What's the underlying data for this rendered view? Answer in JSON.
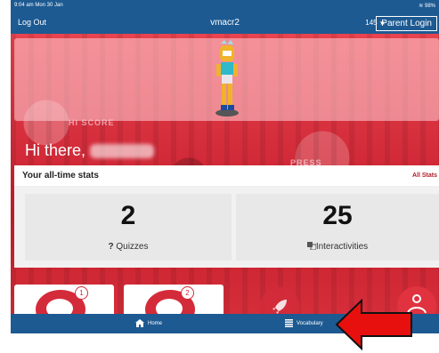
{
  "status": {
    "time": "9:04 am  Mon 30 Jan",
    "battery": "98%"
  },
  "nav": {
    "logout": "Log Out",
    "title": "vmacr2",
    "stars": "145 ★",
    "parent_login": "Parent Login"
  },
  "greeting": {
    "text": "Hi there, "
  },
  "stats": {
    "title": "Your all-time stats",
    "all_stats": "All Stats",
    "quizzes": {
      "value": "2",
      "icon": "?",
      "label": "Quizzes"
    },
    "interactivities": {
      "value": "25",
      "label": "Interactivities"
    }
  },
  "tiles": [
    {
      "badge": "1"
    },
    {
      "badge": "2"
    }
  ],
  "tabs": {
    "home": "Home",
    "vocabulary": "Vocabulary"
  },
  "bg_text": {
    "hiscore": "HI SCORE",
    "press": "PRESS"
  },
  "colors": {
    "nav": "#1d5a92",
    "accent": "#d42b3a",
    "arrow": "#e8100e"
  }
}
